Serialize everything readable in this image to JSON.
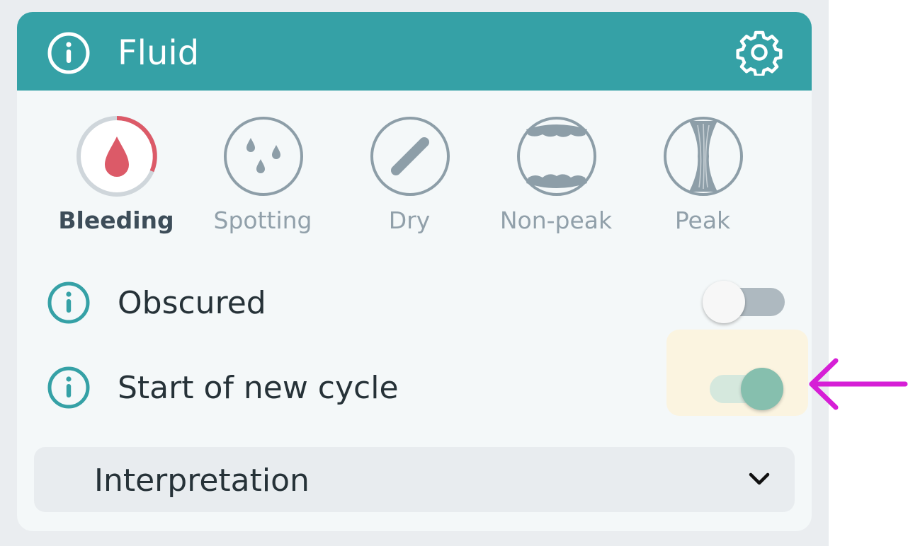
{
  "panel": {
    "title": "Fluid",
    "header_color": "#35a1a6"
  },
  "fluid_options": [
    {
      "label": "Bleeding",
      "icon": "blood-drop-icon",
      "selected": true
    },
    {
      "label": "Spotting",
      "icon": "droplets-icon",
      "selected": false
    },
    {
      "label": "Dry",
      "icon": "dry-slash-icon",
      "selected": false
    },
    {
      "label": "Non-peak",
      "icon": "non-peak-icon",
      "selected": false
    },
    {
      "label": "Peak",
      "icon": "peak-icon",
      "selected": false
    }
  ],
  "toggles": {
    "obscured": {
      "label": "Obscured",
      "on": false
    },
    "new_cycle": {
      "label": "Start of new cycle",
      "on": true
    }
  },
  "interpretation": {
    "label": "Interpretation"
  },
  "colors": {
    "accent": "#35a1a6",
    "bleeding": "#dc5a68",
    "toggle_on": "#86bfae",
    "annotation_arrow": "#d61fd6",
    "highlight": "#fbf4e0"
  }
}
